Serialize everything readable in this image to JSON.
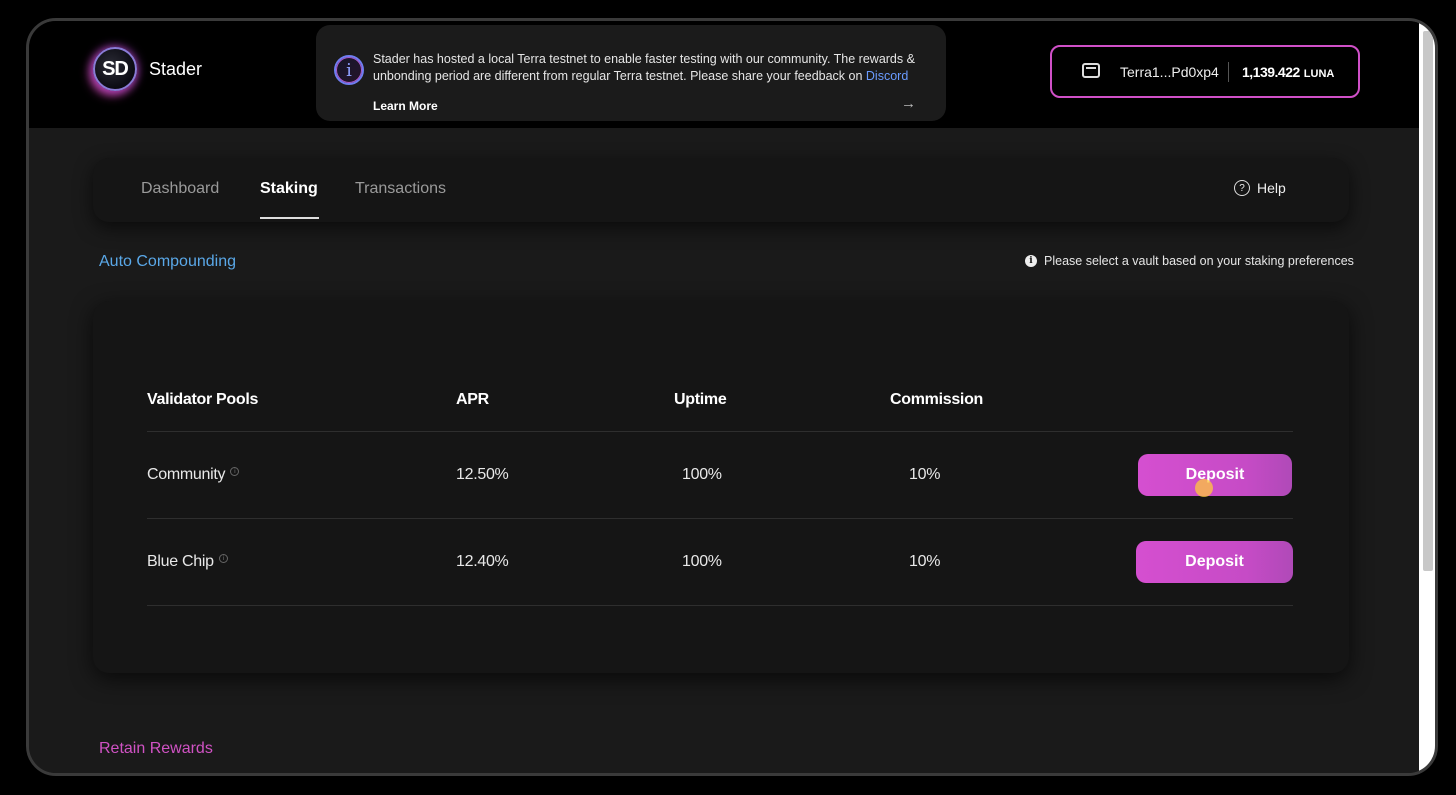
{
  "app": {
    "name": "Stader",
    "logo_initials": "SD"
  },
  "notice": {
    "text": "Stader has hosted a local Terra testnet to enable faster testing with our community. The rewards & unbonding period are different from regular Terra testnet. Please share your feedback on ",
    "link": "Discord",
    "learn_more": "Learn More",
    "arrow": "→"
  },
  "wallet": {
    "address": "Terra1...Pd0xp4",
    "balance": "1,139.422",
    "unit": "LUNA"
  },
  "nav": {
    "tabs": [
      {
        "label": "Dashboard",
        "active": false
      },
      {
        "label": "Staking",
        "active": true
      },
      {
        "label": "Transactions",
        "active": false
      }
    ],
    "help": "Help"
  },
  "sections": {
    "auto": "Auto Compounding",
    "preference_note": "Please select a vault based on your staking preferences",
    "retain": "Retain Rewards"
  },
  "table": {
    "headers": [
      "Validator Pools",
      "APR",
      "Uptime",
      "Commission"
    ],
    "rows": [
      {
        "pool": "Community",
        "apr": "12.50%",
        "uptime": "100%",
        "commission": "10%",
        "action": "Deposit"
      },
      {
        "pool": "Blue Chip",
        "apr": "12.40%",
        "uptime": "100%",
        "commission": "10%",
        "action": "Deposit"
      }
    ]
  },
  "colors": {
    "accent_pink": "#d54fd0",
    "accent_blue": "#5aa8e8",
    "background": "#1a1a1a"
  },
  "icons": [
    "wallet-icon",
    "info-icon",
    "help-icon",
    "arrow-right-icon"
  ]
}
